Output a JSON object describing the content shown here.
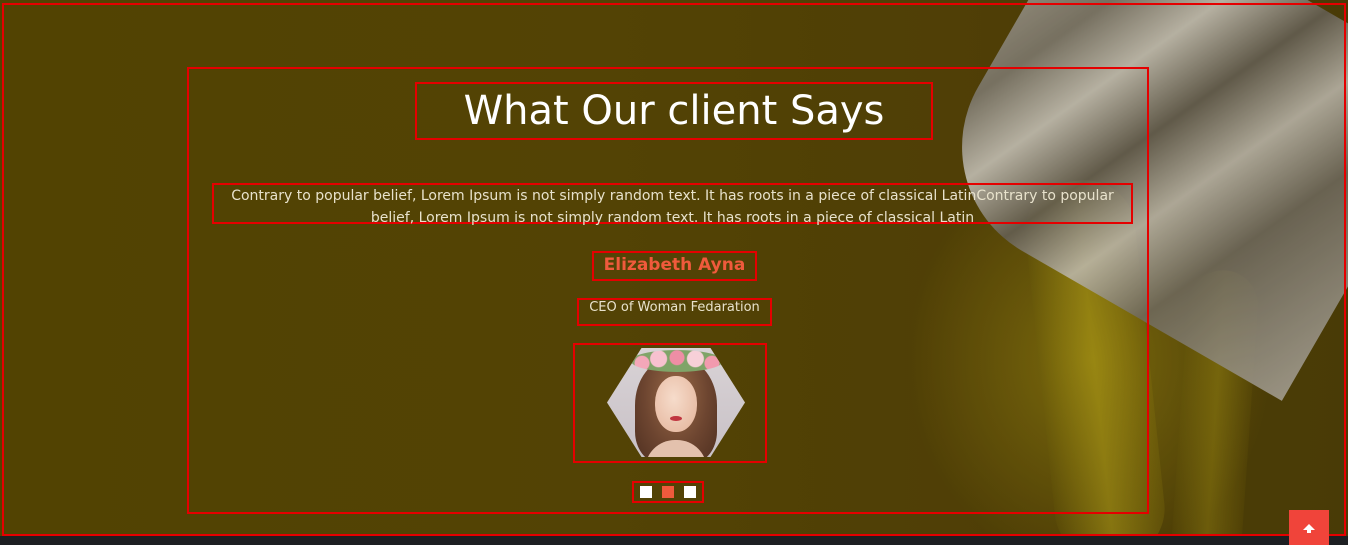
{
  "testimonial": {
    "heading": "What Our client Says",
    "quote": "Contrary to popular belief, Lorem Ipsum is not simply random text. It has roots in a piece of classical LatinContrary to popular belief, Lorem Ipsum is not simply random text. It has roots in a piece of classical Latin",
    "client_name": "Elizabeth Ayna",
    "client_role": "CEO of Woman Fedaration",
    "avatar_icon": "client-avatar-hexagon",
    "slider_dots": [
      {
        "state": "inactive"
      },
      {
        "state": "active"
      },
      {
        "state": "inactive"
      }
    ],
    "active_slide": 2,
    "slide_count": 3
  },
  "back_to_top": {
    "icon": "arrow-up-icon"
  },
  "colors": {
    "accent": "#f05a3c",
    "heading_text": "#ffffff",
    "body_text": "#e8e2cc",
    "background": "#5a4a03",
    "annotation_border": "#e50000",
    "footer": "#1d1f22",
    "back_to_top_bg": "#f0443a"
  }
}
